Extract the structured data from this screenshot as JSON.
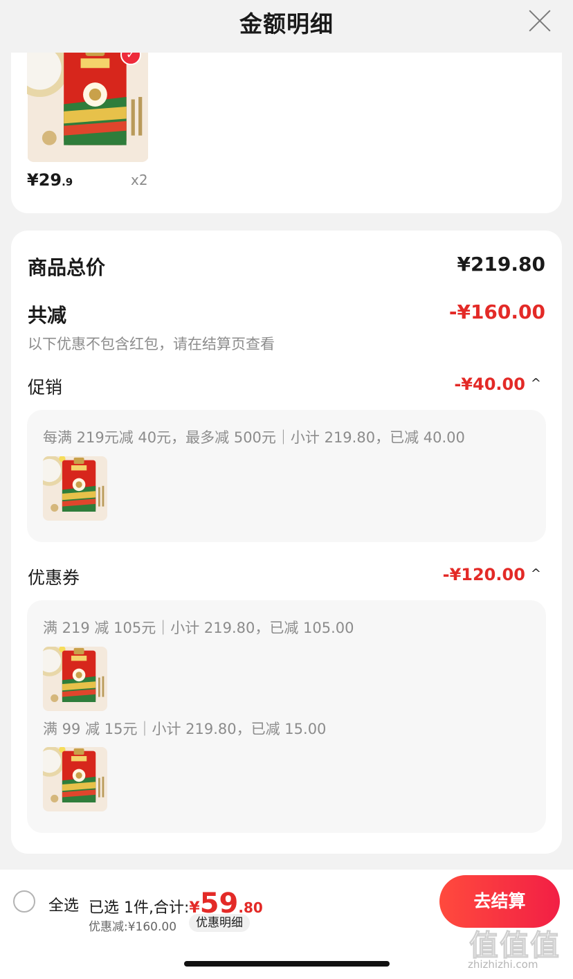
{
  "header": {
    "title": "金额明细"
  },
  "cart_item": {
    "price_main": "¥29",
    "price_cents": ".9",
    "quantity": "x2"
  },
  "summary": {
    "total_label": "商品总价",
    "total_value": "¥219.80",
    "reduced_label": "共减",
    "reduced_value": "-¥160.00",
    "hint": "以下优惠不包含红包，请在结算页查看"
  },
  "promotion": {
    "label": "促销",
    "value": "-¥40.00",
    "rule": "每满 219元减 40元，最多减 500元｜小计 219.80，已减 40.00"
  },
  "coupon": {
    "label": "优惠券",
    "value": "-¥120.00",
    "rules": [
      "满 219 减 105元｜小计 219.80，已减 105.00",
      "满 99 减 15元｜小计 219.80，已减 15.00"
    ]
  },
  "bottom": {
    "select_all": "全选",
    "selected_text": "已选 1件,合计:",
    "yen": "¥",
    "total_int": "59",
    "total_cents": ".80",
    "discount_text": "优惠减:¥160.00",
    "detail_chip": "优惠明细",
    "checkout": "去结算"
  },
  "watermark": {
    "logo": "值值值",
    "url": "zhizhizhi.com"
  },
  "icons": {
    "close": "close-icon",
    "check": "checkmark-icon",
    "caret": "caret-up-icon",
    "radio": "radio-unchecked-icon"
  },
  "colors": {
    "accent": "#e32a27",
    "checkout_gradient_start": "#ff4a3d",
    "checkout_gradient_end": "#f21f45"
  }
}
